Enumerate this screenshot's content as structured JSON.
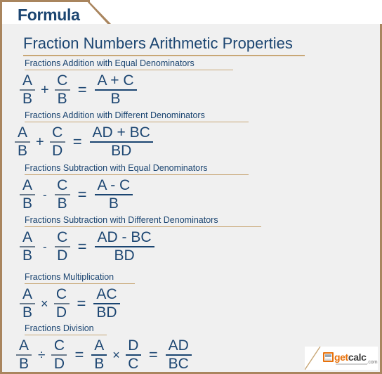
{
  "header": {
    "tab_label": "Formula"
  },
  "title": "Fraction Numbers Arithmetic Properties",
  "sections": [
    {
      "label": "Fractions Addition with Equal Denominators",
      "equation": {
        "left_num": "A",
        "left_den": "B",
        "operator": "+",
        "right_num": "C",
        "right_den": "B",
        "equals": "=",
        "result_num": "A + C",
        "result_den": "B"
      }
    },
    {
      "label": "Fractions Addition with Different Denominators",
      "equation": {
        "left_num": "A",
        "left_den": "B",
        "operator": "+",
        "right_num": "C",
        "right_den": "D",
        "equals": "=",
        "result_num": "AD + BC",
        "result_den": "BD"
      }
    },
    {
      "label": "Fractions Subtraction with Equal Denominators",
      "equation": {
        "left_num": "A",
        "left_den": "B",
        "operator": "-",
        "right_num": "C",
        "right_den": "B",
        "equals": "=",
        "result_num": "A - C",
        "result_den": "B"
      }
    },
    {
      "label": "Fractions Subtraction with Different Denominators",
      "equation": {
        "left_num": "A",
        "left_den": "B",
        "operator": "-",
        "right_num": "C",
        "right_den": "D",
        "equals": "=",
        "result_num": "AD - BC",
        "result_den": "BD"
      }
    },
    {
      "label": "Fractions Multiplication",
      "equation": {
        "left_num": "A",
        "left_den": "B",
        "operator": "×",
        "right_num": "C",
        "right_den": "D",
        "equals": "=",
        "result_num": "AC",
        "result_den": "BD"
      }
    },
    {
      "label": "Fractions Division",
      "equation": {
        "left_num": "A",
        "left_den": "B",
        "operator": "÷",
        "right_num": "C",
        "right_den": "D",
        "equals": "=",
        "mid_num": "A",
        "mid_den": "B",
        "operator2": "×",
        "mid2_num": "D",
        "mid2_den": "C",
        "equals2": "=",
        "result_num": "AD",
        "result_den": "BC"
      }
    }
  ],
  "logo": {
    "get": "get",
    "calc": "calc",
    "dotcom": ".com"
  },
  "colors": {
    "accent_blue": "#1b4571",
    "border_tan": "#a9855e",
    "rule_tan": "#c8a776",
    "panel_bg": "#f0f0f0",
    "logo_orange": "#e8710a"
  }
}
